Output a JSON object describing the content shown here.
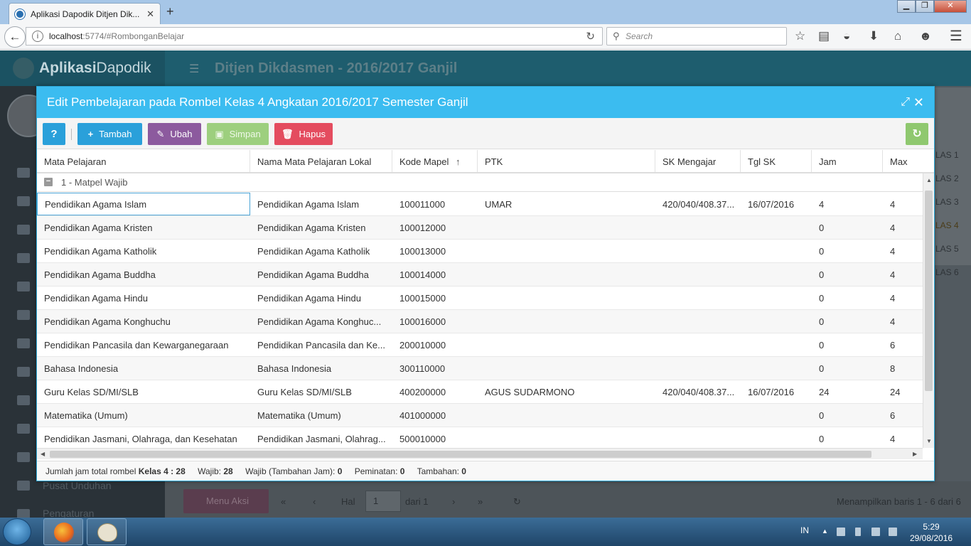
{
  "browser": {
    "tab_title": "Aplikasi Dapodik Ditjen Dik...",
    "url_host": "localhost",
    "url_rest": ":5774/#RombonganBelajar",
    "search_placeholder": "Search"
  },
  "app": {
    "logo_bold": "Aplikasi",
    "logo_light": "Dapodik",
    "header_title": "Ditjen Dikdasmen - 2016/2017 Ganjil",
    "side_labels": [
      "Pusat Unduhan",
      "Pengaturan"
    ],
    "right_list": [
      "LAS 1",
      "LAS 2",
      "LAS 3",
      "LAS 4",
      "LAS 5",
      "LAS 6"
    ],
    "menu_aksi": "Menu Aksi",
    "pager": {
      "hal": "Hal",
      "page": "1",
      "of": "dari 1",
      "summary": "Menampilkan baris 1 - 6 dari 6"
    }
  },
  "modal": {
    "title": "Edit Pembelajaran pada Rombel Kelas 4 Angkatan 2016/2017 Semester Ganjil",
    "toolbar": {
      "help": "?",
      "add": "Tambah",
      "edit": "Ubah",
      "save": "Simpan",
      "delete": "Hapus"
    },
    "columns": [
      "Mata Pelajaran",
      "Nama Mata Pelajaran Lokal",
      "Kode Mapel",
      "PTK",
      "SK Mengajar",
      "Tgl SK",
      "Jam",
      "Max"
    ],
    "sort_column": "Kode Mapel",
    "group_label": "1 - Matpel Wajib",
    "rows": [
      {
        "mapel": "Pendidikan Agama Islam",
        "lokal": "Pendidikan Agama Islam",
        "kode": "100011000",
        "ptk": "UMAR",
        "sk": "420/040/408.37...",
        "tgl": "16/07/2016",
        "jam": "4",
        "max": "4"
      },
      {
        "mapel": "Pendidikan Agama Kristen",
        "lokal": "Pendidikan Agama Kristen",
        "kode": "100012000",
        "ptk": "",
        "sk": "",
        "tgl": "",
        "jam": "0",
        "max": "4"
      },
      {
        "mapel": "Pendidikan Agama Katholik",
        "lokal": "Pendidikan Agama Katholik",
        "kode": "100013000",
        "ptk": "",
        "sk": "",
        "tgl": "",
        "jam": "0",
        "max": "4"
      },
      {
        "mapel": "Pendidikan Agama Buddha",
        "lokal": "Pendidikan Agama Buddha",
        "kode": "100014000",
        "ptk": "",
        "sk": "",
        "tgl": "",
        "jam": "0",
        "max": "4"
      },
      {
        "mapel": "Pendidikan Agama Hindu",
        "lokal": "Pendidikan Agama Hindu",
        "kode": "100015000",
        "ptk": "",
        "sk": "",
        "tgl": "",
        "jam": "0",
        "max": "4"
      },
      {
        "mapel": "Pendidikan Agama Konghuchu",
        "lokal": "Pendidikan Agama Konghuc...",
        "kode": "100016000",
        "ptk": "",
        "sk": "",
        "tgl": "",
        "jam": "0",
        "max": "4"
      },
      {
        "mapel": "Pendidikan Pancasila dan Kewarganegaraan",
        "lokal": "Pendidikan Pancasila dan Ke...",
        "kode": "200010000",
        "ptk": "",
        "sk": "",
        "tgl": "",
        "jam": "0",
        "max": "6"
      },
      {
        "mapel": "Bahasa Indonesia",
        "lokal": "Bahasa Indonesia",
        "kode": "300110000",
        "ptk": "",
        "sk": "",
        "tgl": "",
        "jam": "0",
        "max": "8"
      },
      {
        "mapel": "Guru Kelas SD/MI/SLB",
        "lokal": "Guru Kelas SD/MI/SLB",
        "kode": "400200000",
        "ptk": "AGUS SUDARMONO",
        "sk": "420/040/408.37...",
        "tgl": "16/07/2016",
        "jam": "24",
        "max": "24"
      },
      {
        "mapel": "Matematika (Umum)",
        "lokal": "Matematika (Umum)",
        "kode": "401000000",
        "ptk": "",
        "sk": "",
        "tgl": "",
        "jam": "0",
        "max": "6"
      },
      {
        "mapel": "Pendidikan Jasmani, Olahraga, dan Kesehatan",
        "lokal": "Pendidikan Jasmani, Olahrag...",
        "kode": "500010000",
        "ptk": "",
        "sk": "",
        "tgl": "",
        "jam": "0",
        "max": "4"
      }
    ],
    "footer": {
      "total_label": "Jumlah jam total rombel",
      "total_value": "Kelas 4 : 28",
      "wajib_label": "Wajib:",
      "wajib_value": "28",
      "tambahan_jam_label": "Wajib (Tambahan Jam):",
      "tambahan_jam_value": "0",
      "peminatan_label": "Peminatan:",
      "peminatan_value": "0",
      "tambahan_label": "Tambahan:",
      "tambahan_value": "0"
    }
  },
  "taskbar": {
    "lang": "IN",
    "time": "5:29",
    "date": "29/08/2016"
  },
  "colors": {
    "modal_header": "#3bbcf0",
    "btn_primary": "#2aa0da",
    "btn_edit": "#8c5a9e",
    "btn_save": "#9dcf7e",
    "btn_delete": "#e44c5f"
  }
}
